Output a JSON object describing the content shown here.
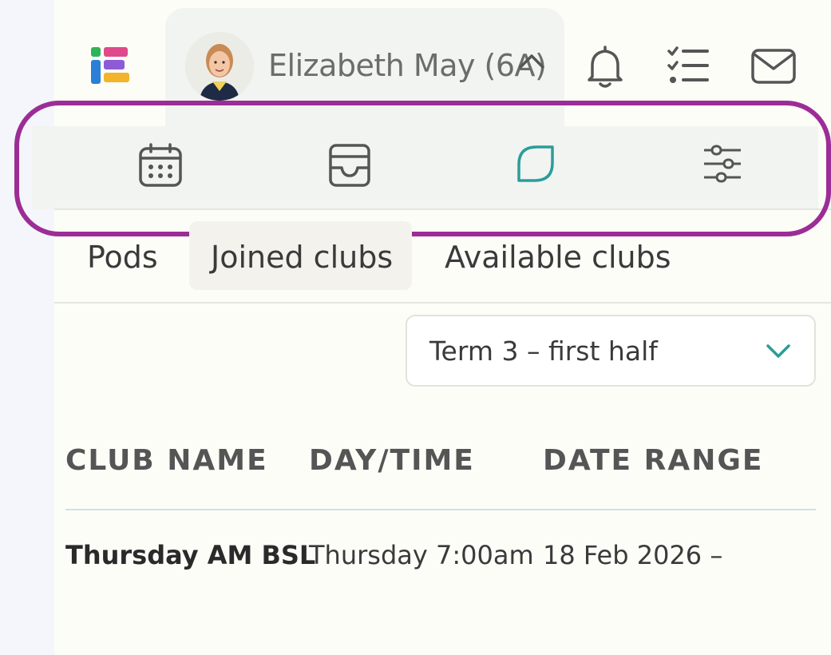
{
  "header": {
    "profile_name": "Elizabeth May (6A)",
    "icons": [
      "app-logo",
      "chevron-up-icon",
      "bell-icon",
      "checklist-icon",
      "mail-icon"
    ]
  },
  "nav": {
    "icons": [
      "calendar-icon",
      "inbox-icon",
      "leaf-icon",
      "sliders-icon"
    ],
    "active": "leaf-icon",
    "accent_color": "#2a9d9a",
    "highlight_color": "#9c2d96"
  },
  "tabs": [
    {
      "label": "Pods"
    },
    {
      "label": "Joined clubs",
      "active": true
    },
    {
      "label": "Available clubs"
    }
  ],
  "filter": {
    "selected": "Term 3 – first half"
  },
  "table": {
    "columns": [
      "CLUB NAME",
      "DAY/TIME",
      "DATE RANGE"
    ],
    "rows": [
      {
        "club_name": "Thursday AM BSL",
        "day_time": "Thursday 7:00am",
        "date_range": "18 Feb 2026 –"
      }
    ]
  }
}
